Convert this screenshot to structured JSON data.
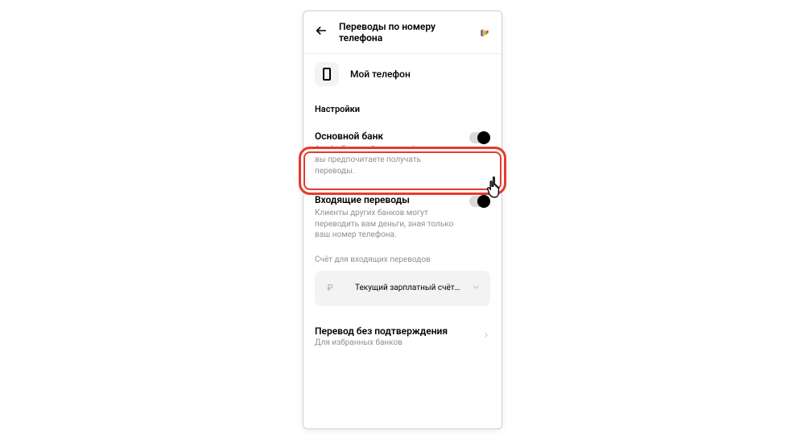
{
  "header": {
    "title": "Переводы по номеру телефона"
  },
  "phoneRow": {
    "label": "Мой телефон"
  },
  "settings": {
    "label": "Настройки",
    "primaryBank": {
      "title": "Основной банк",
      "desc": "Альфа-Банк — банк, на счёт которого вы предпочитаете получать переводы.",
      "enabled": true
    },
    "incoming": {
      "title": "Входящие переводы",
      "desc": "Клиенты других банков могут переводить вам деньги, зная только ваш номер телефона.",
      "enabled": true
    },
    "accountLabel": "Счёт для входящих переводов",
    "account": {
      "currency": "₽",
      "name": "Текущий зарплатный счёт…"
    },
    "noConfirm": {
      "title": "Перевод без подтверждения",
      "sub": "Для избранных банков"
    }
  }
}
